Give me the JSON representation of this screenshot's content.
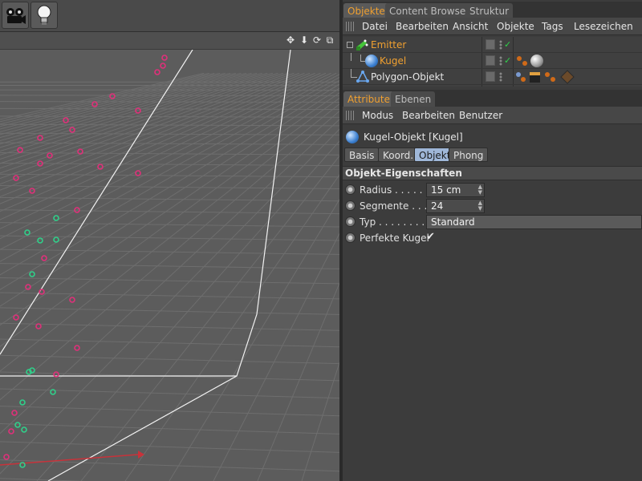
{
  "object_manager": {
    "tabs": [
      {
        "label": "Objekte",
        "active": true
      },
      {
        "label": "Content Browser",
        "active": false
      },
      {
        "label": "Struktur",
        "active": false
      }
    ],
    "menu": [
      "Datei",
      "Bearbeiten",
      "Ansicht",
      "Objekte",
      "Tags",
      "Lesezeichen"
    ],
    "objects": [
      {
        "name": "Emitter",
        "color": "#f0a030",
        "icon": "emitter-icon"
      },
      {
        "name": "Kugel",
        "color": "#f0a030",
        "icon": "sphere-icon"
      },
      {
        "name": "Polygon-Objekt",
        "color": "#e6e6e6",
        "icon": "polygon-icon"
      }
    ]
  },
  "attribute_manager": {
    "tabs": [
      {
        "label": "Attribute",
        "active": true
      },
      {
        "label": "Ebenen",
        "active": false
      }
    ],
    "menu": [
      "Modus",
      "Bearbeiten",
      "Benutzer"
    ],
    "object_title": "Kugel-Objekt [Kugel]",
    "subtabs": [
      {
        "label": "Basis",
        "active": false
      },
      {
        "label": "Koord.",
        "active": false
      },
      {
        "label": "Objekt",
        "active": true
      },
      {
        "label": "Phong",
        "active": false
      }
    ],
    "section_title": "Objekt-Eigenschaften",
    "properties": {
      "radius_label": "Radius . . . . . . .",
      "radius_value": "15 cm",
      "segments_label": "Segmente . . . .",
      "segments_value": "24",
      "type_label": "Typ . . . . . . . . .",
      "type_value": "Standard",
      "perfect_label": "Perfekte Kugel",
      "perfect_value": "✔"
    }
  },
  "colors": {
    "accent": "#f0a030",
    "check": "#2fd34a",
    "active_subtab": "#9fb7d8",
    "particle_pink": "#e0307a",
    "particle_green": "#2fd08a"
  }
}
